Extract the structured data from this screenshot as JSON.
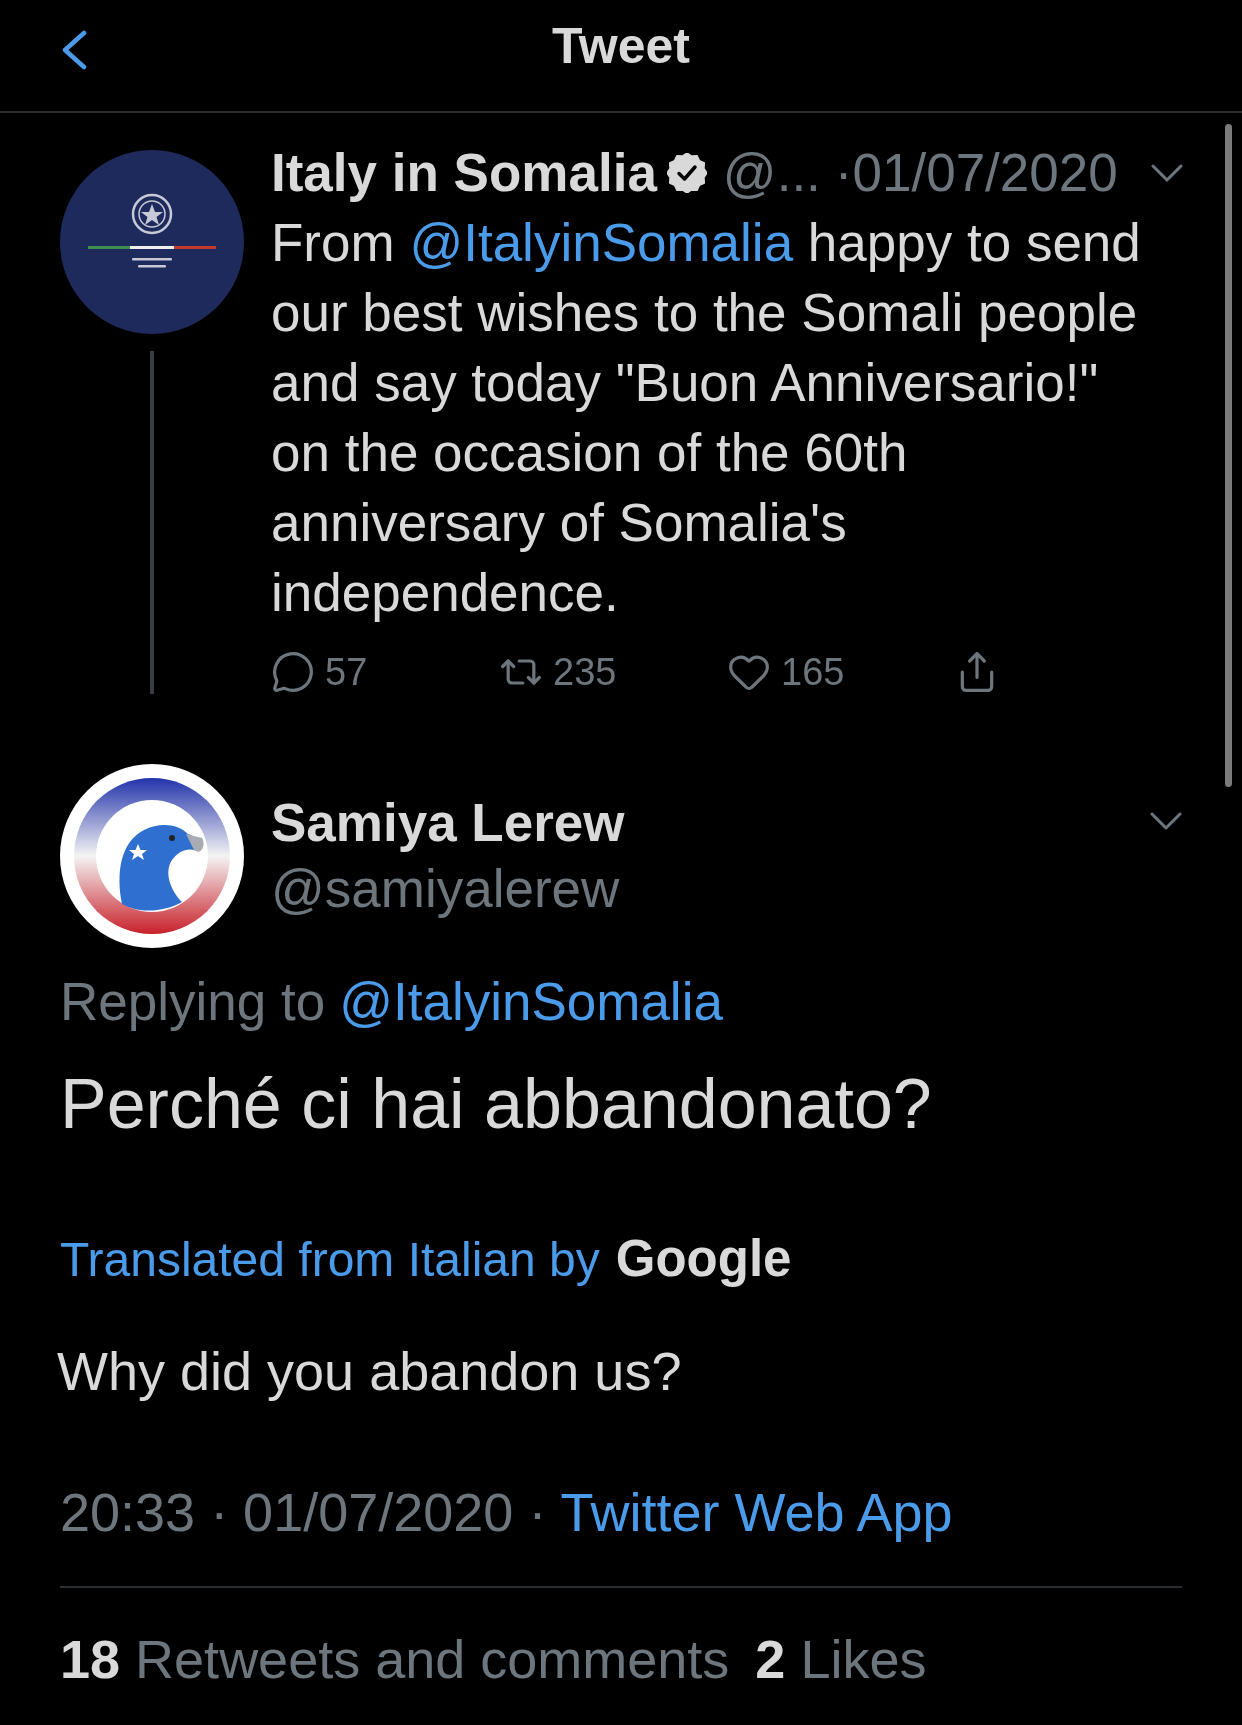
{
  "header": {
    "title": "Tweet"
  },
  "parent_tweet": {
    "name": "Italy in Somalia",
    "verified": true,
    "handle": "@...",
    "date": "·01/07/2020",
    "text": [
      {
        "kind": "plain",
        "text": "From "
      },
      {
        "kind": "mention",
        "text": "@ItalyinSomalia"
      },
      {
        "kind": "plain",
        "text": " happy to send our best wishes to the Somali people and say today \"Buon Anniversario!\" on the occasion of the 60th anniversary of Somalia's independence."
      }
    ],
    "actions": [
      {
        "kind": "reply",
        "count": "57"
      },
      {
        "kind": "retweet",
        "count": "235"
      },
      {
        "kind": "like",
        "count": "165"
      },
      {
        "kind": "share"
      }
    ]
  },
  "tweet": {
    "name": "Samiya Lerew",
    "handle": "@samiyalerew",
    "replying_to": {
      "label": "Replying to",
      "mention": "@ItalyinSomalia"
    },
    "text": "Perché ci hai abbandonato?",
    "translation": {
      "label": "Translated from Italian by",
      "provider": "Google",
      "text": "Why did you abandon us?"
    },
    "meta": {
      "timestamp": "20:33 · 01/07/2020 ·",
      "source": "Twitter Web App"
    },
    "stats": [
      {
        "count": "18",
        "label": "Retweets and comments"
      },
      {
        "count": "2",
        "label": "Likes"
      }
    ]
  }
}
